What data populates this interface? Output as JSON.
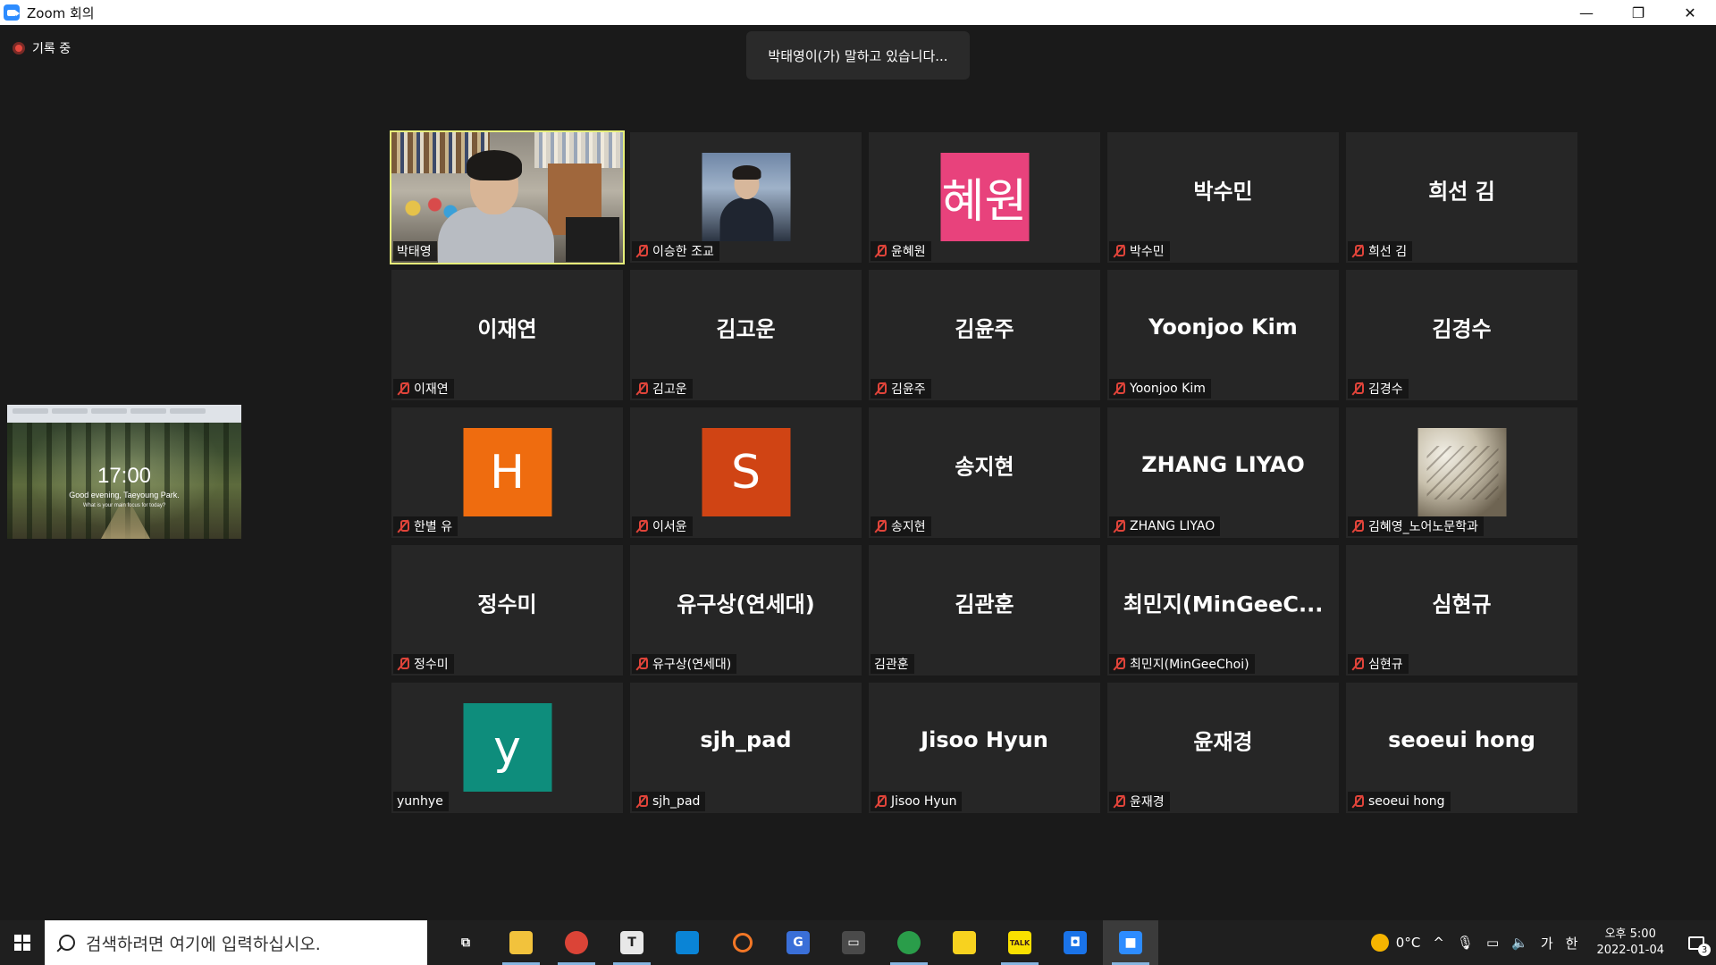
{
  "window": {
    "title": "Zoom 회의",
    "minimize": "—",
    "restore": "❐",
    "close": "✕"
  },
  "recording": {
    "label": "기록 중"
  },
  "speaking_toast": "박태영이(가) 말하고 있습니다...",
  "share_thumbnail": {
    "clock": "17:00",
    "greeting": "Good evening, Taeyoung Park.",
    "focus": "What is your main focus for today?"
  },
  "participants": [
    {
      "type": "video",
      "label": "박태영",
      "muted": false,
      "speaking": true
    },
    {
      "type": "photo-man",
      "label": "이승한 조교",
      "muted": true
    },
    {
      "type": "avatar",
      "avatar_text": "혜원",
      "avatar_color": "#e8427c",
      "label": "윤혜원",
      "muted": true
    },
    {
      "type": "name",
      "center": "박수민",
      "label": "박수민",
      "muted": true
    },
    {
      "type": "name",
      "center": "희선 김",
      "label": "희선 김",
      "muted": true
    },
    {
      "type": "name",
      "center": "이재연",
      "label": "이재연",
      "muted": true
    },
    {
      "type": "name",
      "center": "김고운",
      "label": "김고운",
      "muted": true
    },
    {
      "type": "name",
      "center": "김윤주",
      "label": "김윤주",
      "muted": true
    },
    {
      "type": "name",
      "center": "Yoonjoo Kim",
      "label": "Yoonjoo Kim",
      "muted": true
    },
    {
      "type": "name",
      "center": "김경수",
      "label": "김경수",
      "muted": true
    },
    {
      "type": "avatar",
      "avatar_text": "H",
      "avatar_color": "#ef6c0f",
      "label": "한별 유",
      "muted": true
    },
    {
      "type": "avatar",
      "avatar_text": "S",
      "avatar_color": "#d04414",
      "label": "이서윤",
      "muted": true
    },
    {
      "type": "name",
      "center": "송지현",
      "label": "송지현",
      "muted": true
    },
    {
      "type": "name",
      "center": "ZHANG LIYAO",
      "label": "ZHANG LIYAO",
      "muted": true
    },
    {
      "type": "photo-nature",
      "label": "김혜영_노어노문학과",
      "muted": true
    },
    {
      "type": "name",
      "center": "정수미",
      "label": "정수미",
      "muted": true
    },
    {
      "type": "name",
      "center": "유구상(연세대)",
      "label": "유구상(연세대)",
      "muted": true
    },
    {
      "type": "name",
      "center": "김관훈",
      "label": "김관훈",
      "muted": false
    },
    {
      "type": "name",
      "center": "최민지(MinGeeC...",
      "label": "최민지(MinGeeChoi)",
      "muted": true
    },
    {
      "type": "name",
      "center": "심현규",
      "label": "심현규",
      "muted": true
    },
    {
      "type": "avatar",
      "avatar_text": "y",
      "avatar_color": "#0e8d7c",
      "label": "yunhye",
      "muted": false
    },
    {
      "type": "name",
      "center": "sjh_pad",
      "label": "sjh_pad",
      "muted": true
    },
    {
      "type": "name",
      "center": "Jisoo Hyun",
      "label": "Jisoo Hyun",
      "muted": true
    },
    {
      "type": "name",
      "center": "윤재경",
      "label": "윤재경",
      "muted": true
    },
    {
      "type": "name",
      "center": "seoeui hong",
      "label": "seoeui hong",
      "muted": true
    }
  ],
  "taskbar": {
    "search_placeholder": "검색하려면 여기에 입력하십시오.",
    "apps": [
      {
        "name": "task-view-icon",
        "glyph": "⧉",
        "color": "transparent",
        "running": false
      },
      {
        "name": "file-explorer-icon",
        "glyph": "",
        "color": "#f2c23c",
        "running": true
      },
      {
        "name": "chrome-icon",
        "glyph": "",
        "color": "#db4437",
        "running": true
      },
      {
        "name": "typora-icon",
        "glyph": "T",
        "color": "#e8e8e8",
        "running": true
      },
      {
        "name": "vscode-icon",
        "glyph": "",
        "color": "#0a84d6",
        "running": false
      },
      {
        "name": "jupyter-icon",
        "glyph": "",
        "color": "transparent",
        "running": false
      },
      {
        "name": "gsuite-icon",
        "glyph": "G",
        "color": "#3a6fd8",
        "running": false
      },
      {
        "name": "terminal-icon",
        "glyph": "▭",
        "color": "#4a4a4a",
        "running": false
      },
      {
        "name": "chrome-profile-icon",
        "glyph": "",
        "color": "#2a9d4a",
        "running": true
      },
      {
        "name": "sticky-notes-icon",
        "glyph": "",
        "color": "#f7d21f",
        "running": false
      },
      {
        "name": "kakaotalk-icon",
        "glyph": "TALK",
        "color": "#f9e000",
        "running": true
      },
      {
        "name": "unknown-app-icon",
        "glyph": "◘",
        "color": "#1a73e8",
        "running": false
      },
      {
        "name": "zoom-icon",
        "glyph": "■",
        "color": "#2d8cff",
        "running": true,
        "active": true
      }
    ],
    "weather": "0°C",
    "tray_chevron": "^",
    "ime_ga": "가",
    "ime_han": "한",
    "time": "오후 5:00",
    "date": "2022-01-04",
    "notification_count": "3"
  }
}
